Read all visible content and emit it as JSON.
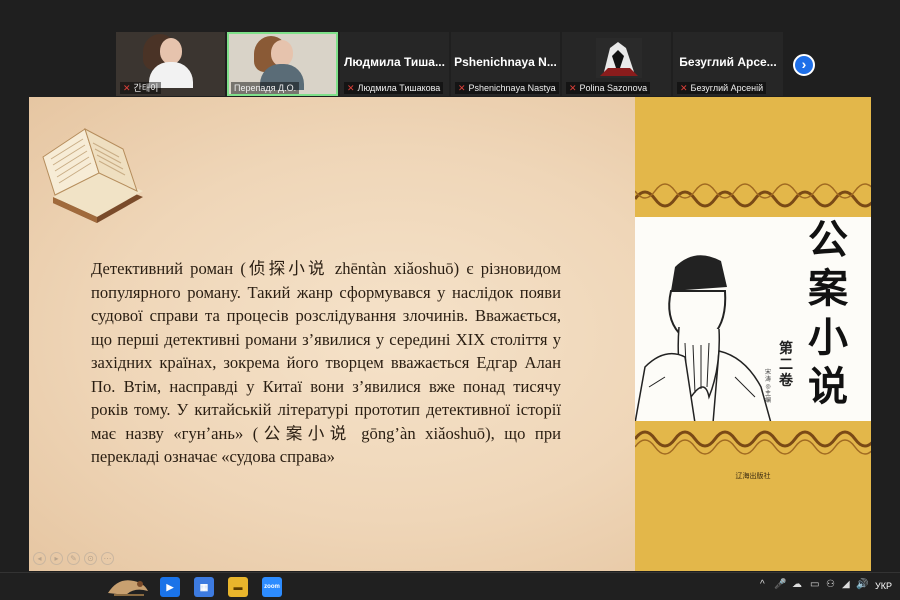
{
  "participants": [
    {
      "name": "",
      "label": "간태이",
      "type": "video",
      "hair": "#4a3326",
      "shirt": "#f2f2f2"
    },
    {
      "name": "",
      "label": "Перепадя Д.О.",
      "type": "video",
      "hair": "#8a5a36",
      "shirt": "#5a6c77",
      "active": true
    },
    {
      "name": "Людмила Тиша...",
      "label": "Людмила Тишакова",
      "type": "name"
    },
    {
      "name": "Pshenichnaya N...",
      "label": "Pshenichnaya Nastya",
      "type": "name"
    },
    {
      "name": "",
      "label": "Polina Sazonova",
      "type": "avatar"
    },
    {
      "name": "Безуглий Арсе...",
      "label": "Безуглий Арсеній",
      "type": "name"
    }
  ],
  "next_button": "›",
  "slide": {
    "paragraph": "Детективний роман (侦探小说 zhēntàn xiǎoshuō) є різновидом популярного роману. Такий жанр сформувався у наслідок появи судової справи та процесів розслідування злочинів. Вважається, що перші детективні романи з’явилися у середині XIX століття у західних країнах, зокрема його творцем вважається Едгар Алан По. Втім, насправді у Китаї вони з’явилися вже понад тисячу років тому. У китайській літературі прототип детективної історії має назву «гунʼань» (公案小说 gōng’àn xiǎoshuō), що при перекладі означає «судова справа»",
    "cover": {
      "title": "公案小说",
      "volume": "第二卷",
      "author": "宋 涛 ◎ 主编",
      "publisher": "辽海出版社"
    }
  },
  "slide_controls": [
    "◂",
    "▸",
    "✎",
    "⊙",
    "⋯"
  ],
  "taskbar": {
    "apps": [
      "bird-app",
      "meet",
      "store",
      "explorer",
      "zoom"
    ],
    "zoom_label": "zoom",
    "tray_icons": [
      "^",
      "🎤",
      "☁",
      "▭",
      "⚇",
      "◢",
      "🔊"
    ],
    "language": "УКР"
  },
  "colors": {
    "mic_off": "#e0413a",
    "active_border": "#7fe08a",
    "cover_yellow": "#e3b74a",
    "slide_bg": "#efd6b8",
    "next_button": "#1e6fe8"
  }
}
